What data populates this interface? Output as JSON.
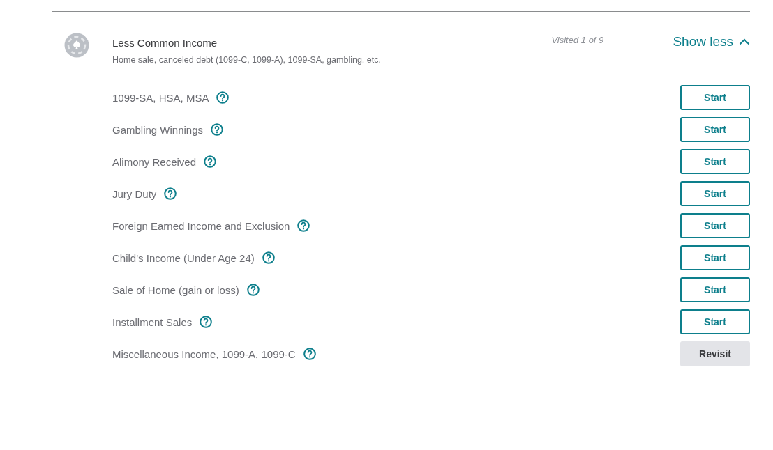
{
  "section": {
    "title": "Less Common Income",
    "subtitle": "Home sale, canceled debt (1099-C, 1099-A), 1099-SA, gambling, etc.",
    "progress": "Visited 1 of 9",
    "toggle": {
      "label": "Show less",
      "expanded": true
    }
  },
  "items": [
    {
      "label": "1099-SA, HSA, MSA",
      "action": {
        "kind": "start",
        "label": "Start"
      }
    },
    {
      "label": "Gambling Winnings",
      "action": {
        "kind": "start",
        "label": "Start"
      }
    },
    {
      "label": "Alimony Received",
      "action": {
        "kind": "start",
        "label": "Start"
      }
    },
    {
      "label": "Jury Duty",
      "action": {
        "kind": "start",
        "label": "Start"
      }
    },
    {
      "label": "Foreign Earned Income and Exclusion",
      "action": {
        "kind": "start",
        "label": "Start"
      }
    },
    {
      "label": "Child's Income (Under Age 24)",
      "action": {
        "kind": "start",
        "label": "Start"
      }
    },
    {
      "label": "Sale of Home (gain or loss)",
      "action": {
        "kind": "start",
        "label": "Start"
      }
    },
    {
      "label": "Installment Sales",
      "action": {
        "kind": "start",
        "label": "Start"
      }
    },
    {
      "label": "Miscellaneous Income, 1099-A, 1099-C",
      "action": {
        "kind": "revisit",
        "label": "Revisit"
      }
    }
  ]
}
